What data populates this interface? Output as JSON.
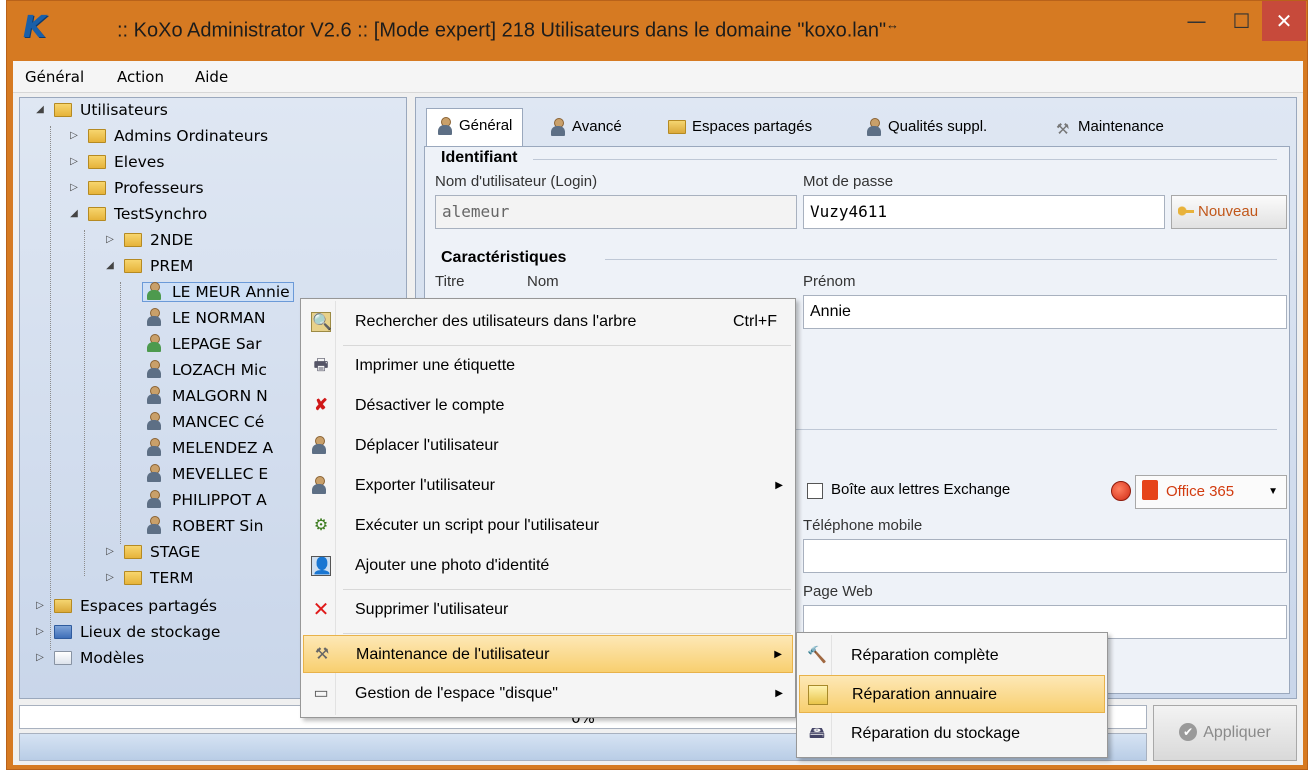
{
  "window": {
    "title": ":: KoXo Administrator V2.6 :: [Mode expert] 218 Utilisateurs dans le domaine \"koxo.lan\"",
    "title_glyph": "↔",
    "minimize": "—",
    "maximize": "☐",
    "close": "✕",
    "logo": "K"
  },
  "menu": [
    "Général",
    "Action",
    "Aide"
  ],
  "tree": {
    "root": "Utilisateurs",
    "groups": [
      "Admins Ordinateurs",
      "Eleves",
      "Professeurs",
      "TestSynchro"
    ],
    "testsynchro_children": [
      "2NDE",
      "PREM"
    ],
    "users": [
      "LE MEUR Annie",
      "LE NORMAN",
      "LEPAGE Sar",
      "LOZACH Mic",
      "MALGORN N",
      "MANCEC Cé",
      "MELENDEZ A",
      "MEVELLEC E",
      "PHILIPPOT A",
      "ROBERT Sin"
    ],
    "after_prem": [
      "STAGE",
      "TERM"
    ],
    "others": [
      "Espaces partagés",
      "Lieux de stockage",
      "Modèles"
    ]
  },
  "tabs": [
    "Général",
    "Avancé",
    "Espaces partagés",
    "Qualités suppl.",
    "Maintenance"
  ],
  "form": {
    "identifiant_title": "Identifiant",
    "login_label": "Nom d'utilisateur (Login)",
    "login_value": "alemeur",
    "password_label": "Mot de passe",
    "password_value": "Vuzy4611",
    "new_button": "Nouveau",
    "carac_title": "Caractéristiques",
    "titre_label": "Titre",
    "nom_label": "Nom",
    "prenom_label": "Prénom",
    "prenom_value": "Annie",
    "exchange_label": "Boîte aux lettres Exchange",
    "office_button": "Office 365",
    "mobile_label": "Téléphone mobile",
    "web_label": "Page Web"
  },
  "progress": "0%",
  "apply_button": "Appliquer",
  "context_menu": {
    "items": [
      {
        "label": "Rechercher des utilisateurs dans l'arbre",
        "shortcut": "Ctrl+F",
        "icon": "search-icon"
      },
      {
        "label": "Imprimer une étiquette",
        "icon": "printer-icon"
      },
      {
        "label": "Désactiver le compte",
        "icon": "disable-user-icon"
      },
      {
        "label": "Déplacer l'utilisateur",
        "icon": "move-user-icon"
      },
      {
        "label": "Exporter l'utilisateur",
        "icon": "export-user-icon"
      },
      {
        "label": "Exécuter un script pour l'utilisateur",
        "icon": "script-icon"
      },
      {
        "label": "Ajouter une photo d'identité",
        "icon": "photo-icon"
      },
      {
        "label": "Supprimer l'utilisateur",
        "icon": "delete-icon"
      },
      {
        "label": "Maintenance de l'utilisateur",
        "icon": "tools-icon"
      },
      {
        "label": "Gestion de l'espace \"disque\"",
        "icon": "disk-icon"
      }
    ]
  },
  "submenu": {
    "items": [
      {
        "label": "Réparation complète",
        "icon": "hammer-icon"
      },
      {
        "label": "Réparation annuaire",
        "icon": "directory-icon"
      },
      {
        "label": "Réparation du stockage",
        "icon": "storage-icon"
      }
    ]
  },
  "colors": {
    "title_bar": "#d67a22",
    "close_button": "#c74a3b",
    "panel": "#c9d6ea",
    "menu_highlight": "#f8cf6f"
  }
}
